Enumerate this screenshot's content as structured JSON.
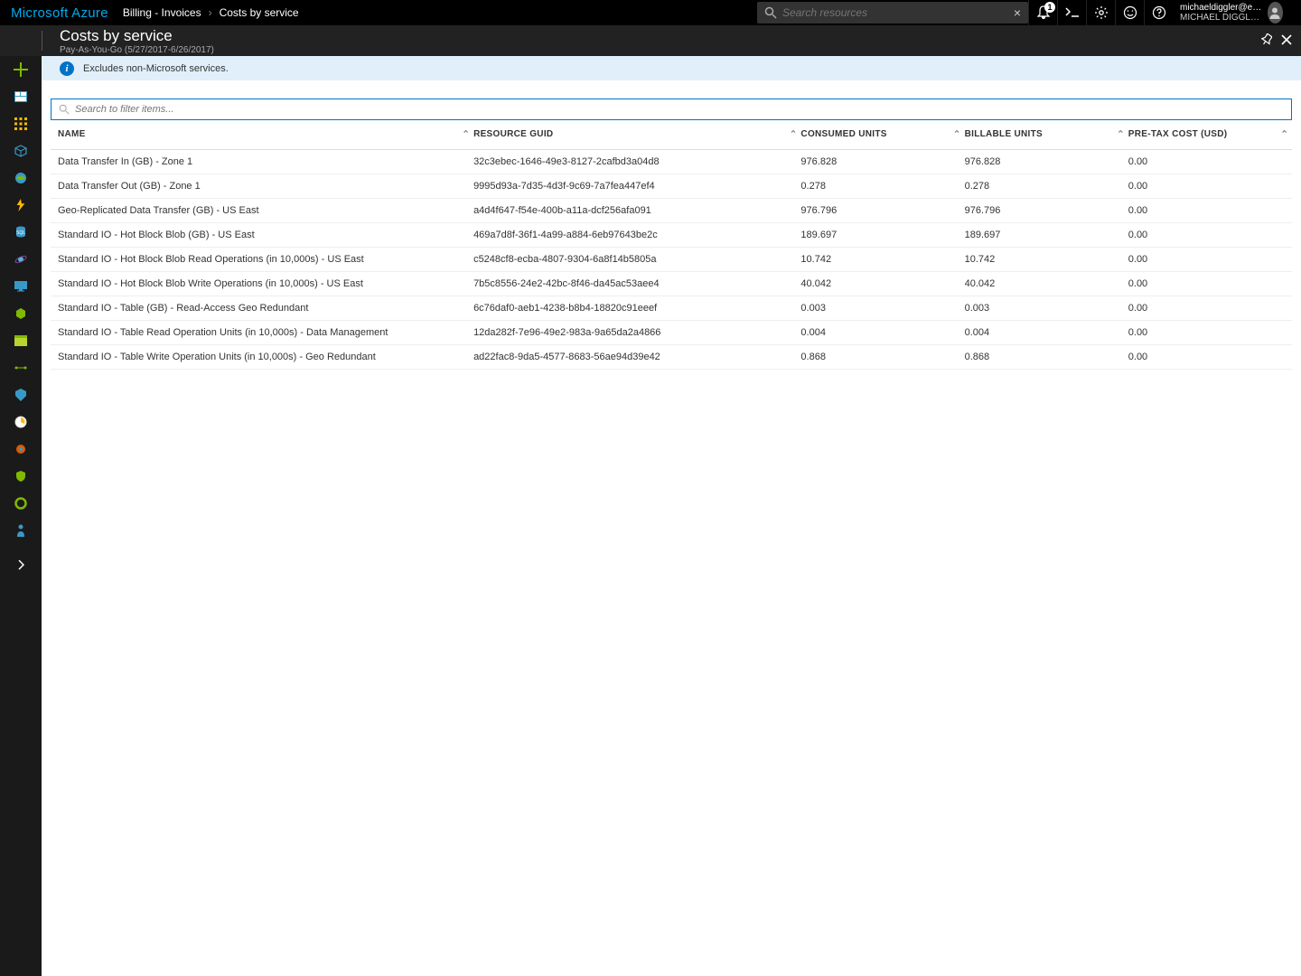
{
  "brand": "Microsoft Azure",
  "breadcrumbs": {
    "part1": "Billing - Invoices",
    "part2": "Costs by service"
  },
  "search": {
    "placeholder": "Search resources",
    "clear": "×"
  },
  "user": {
    "email": "michaeldiggler@ex…",
    "directory": "MICHAEL DIGGLER (DEF…"
  },
  "notifications": {
    "count": "1"
  },
  "titlebar": {
    "title": "Costs by service",
    "subtitle": "Pay-As-You-Go (5/27/2017-6/26/2017)"
  },
  "infobar": {
    "text": "Excludes non-Microsoft services."
  },
  "filter": {
    "placeholder": "Search to filter items..."
  },
  "columns": {
    "name": "NAME",
    "guid": "RESOURCE GUID",
    "consumed": "CONSUMED UNITS",
    "billable": "BILLABLE UNITS",
    "cost": "PRE-TAX COST (USD)"
  },
  "rows": [
    {
      "name": "Data Transfer In (GB) - Zone 1",
      "guid": "32c3ebec-1646-49e3-8127-2cafbd3a04d8",
      "consumed": "976.828",
      "billable": "976.828",
      "cost": "0.00"
    },
    {
      "name": "Data Transfer Out (GB) - Zone 1",
      "guid": "9995d93a-7d35-4d3f-9c69-7a7fea447ef4",
      "consumed": "0.278",
      "billable": "0.278",
      "cost": "0.00"
    },
    {
      "name": "Geo-Replicated Data Transfer (GB) - US East",
      "guid": "a4d4f647-f54e-400b-a11a-dcf256afa091",
      "consumed": "976.796",
      "billable": "976.796",
      "cost": "0.00"
    },
    {
      "name": "Standard IO - Hot Block Blob (GB) - US East",
      "guid": "469a7d8f-36f1-4a99-a884-6eb97643be2c",
      "consumed": "189.697",
      "billable": "189.697",
      "cost": "0.00"
    },
    {
      "name": "Standard IO - Hot Block Blob Read Operations (in 10,000s) - US East",
      "guid": "c5248cf8-ecba-4807-9304-6a8f14b5805a",
      "consumed": "10.742",
      "billable": "10.742",
      "cost": "0.00"
    },
    {
      "name": "Standard IO - Hot Block Blob Write Operations (in 10,000s) - US East",
      "guid": "7b5c8556-24e2-42bc-8f46-da45ac53aee4",
      "consumed": "40.042",
      "billable": "40.042",
      "cost": "0.00"
    },
    {
      "name": "Standard IO - Table (GB) - Read-Access Geo Redundant",
      "guid": "6c76daf0-aeb1-4238-b8b4-18820c91eeef",
      "consumed": "0.003",
      "billable": "0.003",
      "cost": "0.00"
    },
    {
      "name": "Standard IO - Table Read Operation Units (in 10,000s) - Data Management",
      "guid": "12da282f-7e96-49e2-983a-9a65da2a4866",
      "consumed": "0.004",
      "billable": "0.004",
      "cost": "0.00"
    },
    {
      "name": "Standard IO - Table Write Operation Units (in 10,000s) - Geo Redundant",
      "guid": "ad22fac8-9da5-4577-8683-56ae94d39e42",
      "consumed": "0.868",
      "billable": "0.868",
      "cost": "0.00"
    }
  ]
}
